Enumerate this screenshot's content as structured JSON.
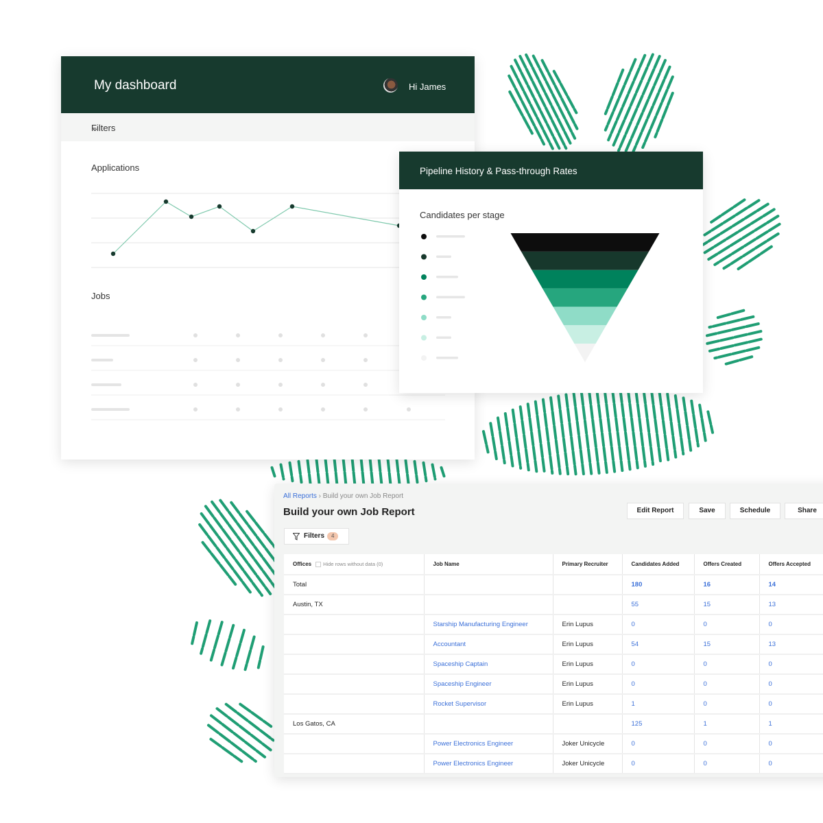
{
  "colors": {
    "header_bg": "#173a2e",
    "link": "#3a6fd8",
    "accent_green": "#1f9e74"
  },
  "dashboard": {
    "title": "My dashboard",
    "greeting": "Hi James",
    "filters_label": "Filters",
    "applications_label": "Applications",
    "jobs_label": "Jobs"
  },
  "pipeline": {
    "title": "Pipeline History & Pass-through Rates",
    "subtitle": "Candidates per stage",
    "stage_colors": [
      "#0d0d0d",
      "#17382c",
      "#00825c",
      "#26a67e",
      "#8fdcc7",
      "#c8efe3",
      "#f3f3f3"
    ]
  },
  "report": {
    "breadcrumb": {
      "root": "All Reports",
      "current": "Build your own Job Report"
    },
    "title": "Build your own Job Report",
    "buttons": [
      "Edit Report",
      "Save",
      "Schedule",
      "Share"
    ],
    "filters": {
      "label": "Filters",
      "count": "4"
    },
    "hide_rows_label": "Hide rows without data (0)",
    "columns": [
      "Offices",
      "Job Name",
      "Primary Recruiter",
      "Candidates Added",
      "Offers Created",
      "Offers Accepted"
    ],
    "rows": [
      {
        "type": "total",
        "office": "Total",
        "job": "",
        "recruiter": "",
        "added": "180",
        "created": "16",
        "accepted": "14"
      },
      {
        "type": "group",
        "office": "Austin, TX",
        "job": "",
        "recruiter": "",
        "added": "55",
        "created": "15",
        "accepted": "13"
      },
      {
        "type": "job",
        "office": "",
        "job": "Starship Manufacturing Engineer",
        "recruiter": "Erin Lupus",
        "added": "0",
        "created": "0",
        "accepted": "0"
      },
      {
        "type": "job",
        "office": "",
        "job": "Accountant",
        "recruiter": "Erin Lupus",
        "added": "54",
        "created": "15",
        "accepted": "13"
      },
      {
        "type": "job",
        "office": "",
        "job": "Spaceship Captain",
        "recruiter": "Erin Lupus",
        "added": "0",
        "created": "0",
        "accepted": "0"
      },
      {
        "type": "job",
        "office": "",
        "job": "Spaceship Engineer",
        "recruiter": "Erin Lupus",
        "added": "0",
        "created": "0",
        "accepted": "0"
      },
      {
        "type": "job",
        "office": "",
        "job": "Rocket Supervisor",
        "recruiter": "Erin Lupus",
        "added": "1",
        "created": "0",
        "accepted": "0"
      },
      {
        "type": "group",
        "office": "Los Gatos, CA",
        "job": "",
        "recruiter": "",
        "added": "125",
        "created": "1",
        "accepted": "1"
      },
      {
        "type": "job",
        "office": "",
        "job": "Power Electronics Engineer",
        "recruiter": "Joker Unicycle",
        "added": "0",
        "created": "0",
        "accepted": "0"
      },
      {
        "type": "job",
        "office": "",
        "job": "Power Electronics Engineer",
        "recruiter": "Joker Unicycle",
        "added": "0",
        "created": "0",
        "accepted": "0"
      }
    ]
  }
}
